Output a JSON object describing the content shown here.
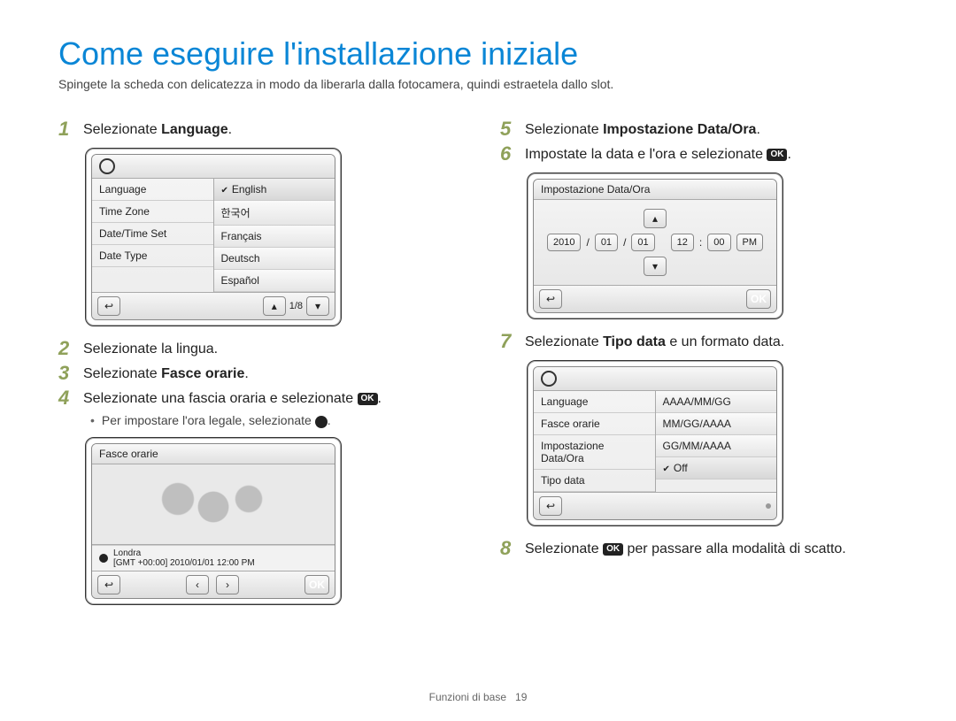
{
  "title": "Come eseguire l'installazione iniziale",
  "subtitle": "Spingete la scheda con delicatezza in modo da liberarla dalla fotocamera, quindi estraetela dallo slot.",
  "ok_label": "OK",
  "steps": {
    "s1": {
      "num": "1",
      "prefix": "Selezionate ",
      "bold": "Language",
      "suffix": "."
    },
    "s2": {
      "num": "2",
      "text": "Selezionate la lingua."
    },
    "s3": {
      "num": "3",
      "prefix": "Selezionate ",
      "bold": "Fasce orarie",
      "suffix": "."
    },
    "s4": {
      "num": "4",
      "text_pre": "Selezionate una fascia oraria e selezionate ",
      "text_post": "."
    },
    "s4b": "Per impostare l'ora legale, selezionate ",
    "s5": {
      "num": "5",
      "prefix": "Selezionate ",
      "bold": "Impostazione Data/Ora",
      "suffix": "."
    },
    "s6": {
      "num": "6",
      "text_pre": "Impostate la data e l'ora e selezionate ",
      "text_post": "."
    },
    "s7": {
      "num": "7",
      "prefix": "Selezionate ",
      "bold": "Tipo data",
      "suffix": " e un formato data."
    },
    "s8": {
      "num": "8",
      "text_pre": "Selezionate ",
      "text_post": " per passare alla modalità di scatto."
    }
  },
  "dev_lang": {
    "left": [
      "Language",
      "Time Zone",
      "Date/Time Set",
      "Date Type"
    ],
    "right": [
      "English",
      "한국어",
      "Français",
      "Deutsch",
      "Español"
    ],
    "page": "1/8"
  },
  "dev_tz": {
    "title": "Fasce orarie",
    "city": "Londra",
    "status": "[GMT +00:00] 2010/01/01 12:00 PM"
  },
  "dev_dt": {
    "title": "Impostazione Data/Ora",
    "y": "2010",
    "m": "01",
    "d": "01",
    "hh": "12",
    "mm": "00",
    "ap": "PM"
  },
  "dev_type": {
    "left": [
      "Language",
      "Fasce orarie",
      "Impostazione Data/Ora",
      "Tipo data"
    ],
    "right": [
      "AAAA/MM/GG",
      "MM/GG/AAAA",
      "GG/MM/AAAA",
      "Off"
    ]
  },
  "footer": {
    "section": "Funzioni di base",
    "page": "19"
  }
}
